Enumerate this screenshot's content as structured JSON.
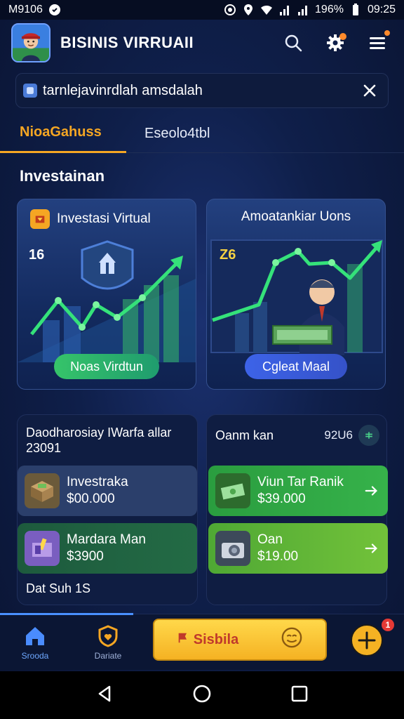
{
  "status_bar": {
    "time_left": "M9106",
    "battery": "196%",
    "time_right": "09:25"
  },
  "header": {
    "title": "BISINIS VIRRUAII"
  },
  "banner": {
    "text": "tarnlejavinrdlah amsdalah"
  },
  "tabs": [
    {
      "label": "NioaGahuss",
      "active": true
    },
    {
      "label": "Eseolo4tbl",
      "active": false
    }
  ],
  "section_title": "Investainan",
  "cards": [
    {
      "title": "Investasi Virtual",
      "number": "16",
      "button": "Noas Virdtun",
      "accent": "#36c46a"
    },
    {
      "title": "Amoatankiar Uons",
      "number": "Z6",
      "button": "Cgleat Maal",
      "accent": "#3d63e8"
    }
  ],
  "panel_left": {
    "title": "Daodharosiay IWarfa allar 23091",
    "items": [
      {
        "name": "Investraka",
        "amount": "$00.000"
      },
      {
        "name": "Mardara Man",
        "amount": "$3900"
      }
    ],
    "footer": "Dat Suh 1S"
  },
  "panel_right": {
    "label": "Oanm kan",
    "count": "92U6",
    "items": [
      {
        "name": "Viun Tar Ranik",
        "amount": "$39.000"
      },
      {
        "name": "Oan",
        "amount": "$19.00"
      }
    ]
  },
  "bottom_nav": {
    "home_label": "Srooda",
    "rank_label": "Dariate",
    "cta_label": "Sisbila",
    "badge": "1"
  }
}
